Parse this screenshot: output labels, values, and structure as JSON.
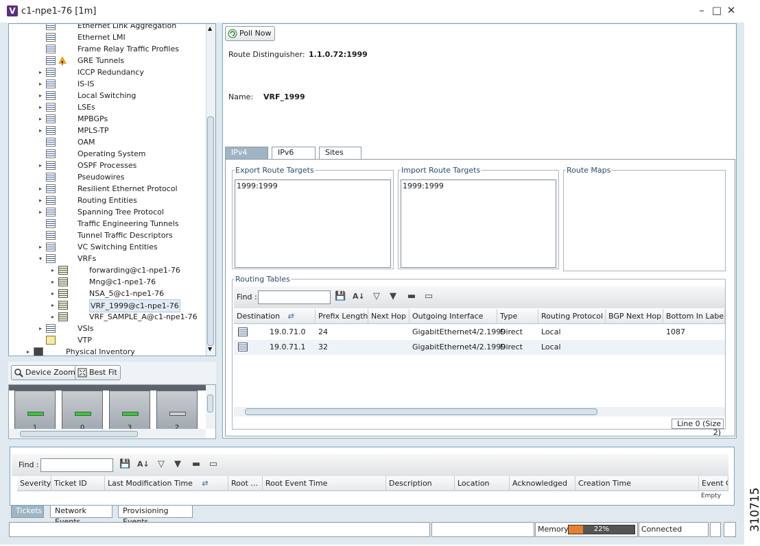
{
  "window": {
    "title": "c1-npe1-76 [1m]",
    "app_letter": "V"
  },
  "tree": {
    "items": [
      {
        "label": "Ethernet Link Aggregation",
        "indent": 1,
        "arrow": "",
        "icon": "gear"
      },
      {
        "label": "Ethernet LMI",
        "indent": 1,
        "arrow": "",
        "icon": "gear"
      },
      {
        "label": "Frame Relay Traffic Profiles",
        "indent": 1,
        "arrow": "",
        "icon": "gear"
      },
      {
        "label": "GRE Tunnels",
        "indent": 1,
        "arrow": "",
        "icon": "gear",
        "warn": true
      },
      {
        "label": "ICCP Redundancy",
        "indent": 1,
        "arrow": "▸",
        "icon": "gear"
      },
      {
        "label": "IS-IS",
        "indent": 1,
        "arrow": "▸",
        "icon": "gear"
      },
      {
        "label": "Local Switching",
        "indent": 1,
        "arrow": "▸",
        "icon": "gear"
      },
      {
        "label": "LSEs",
        "indent": 1,
        "arrow": "▸",
        "icon": "gear"
      },
      {
        "label": "MPBGPs",
        "indent": 1,
        "arrow": "▸",
        "icon": "gear"
      },
      {
        "label": "MPLS-TP",
        "indent": 1,
        "arrow": "▸",
        "icon": "gear"
      },
      {
        "label": "OAM",
        "indent": 1,
        "arrow": "",
        "icon": "gear"
      },
      {
        "label": "Operating System",
        "indent": 1,
        "arrow": "",
        "icon": "gear"
      },
      {
        "label": "OSPF Processes",
        "indent": 1,
        "arrow": "▸",
        "icon": "gear"
      },
      {
        "label": "Pseudowires",
        "indent": 1,
        "arrow": "",
        "icon": "gear"
      },
      {
        "label": "Resilient Ethernet Protocol",
        "indent": 1,
        "arrow": "▸",
        "icon": "gear"
      },
      {
        "label": "Routing Entities",
        "indent": 1,
        "arrow": "▸",
        "icon": "gear"
      },
      {
        "label": "Spanning Tree Protocol",
        "indent": 1,
        "arrow": "▸",
        "icon": "gear"
      },
      {
        "label": "Traffic Engineering Tunnels",
        "indent": 1,
        "arrow": "",
        "icon": "gear"
      },
      {
        "label": "Tunnel Traffic Descriptors",
        "indent": 1,
        "arrow": "",
        "icon": "gear"
      },
      {
        "label": "VC Switching Entities",
        "indent": 1,
        "arrow": "▸",
        "icon": "gear"
      },
      {
        "label": "VRFs",
        "indent": 1,
        "arrow": "▾",
        "icon": "gear"
      },
      {
        "label": "forwarding@c1-npe1-76",
        "indent": 2,
        "arrow": "▸",
        "icon": "vrf"
      },
      {
        "label": "Mng@c1-npe1-76",
        "indent": 2,
        "arrow": "▸",
        "icon": "vrf"
      },
      {
        "label": "NSA_5@c1-npe1-76",
        "indent": 2,
        "arrow": "▸",
        "icon": "vrf"
      },
      {
        "label": "VRF_1999@c1-npe1-76",
        "indent": 2,
        "arrow": "▸",
        "icon": "vrf",
        "selected": true
      },
      {
        "label": "VRF_SAMPLE_A@c1-npe1-76",
        "indent": 2,
        "arrow": "▸",
        "icon": "vrf"
      },
      {
        "label": "VSIs",
        "indent": 1,
        "arrow": "▸",
        "icon": "gear"
      },
      {
        "label": "VTP",
        "indent": 1,
        "arrow": "",
        "icon": "mail"
      },
      {
        "label": "Physical Inventory",
        "indent": 0,
        "arrow": "▸",
        "icon": "chassis"
      }
    ]
  },
  "device_view": {
    "zoom_button": "Device Zoom",
    "fit_button": "Best Fit",
    "slots": [
      {
        "num": "1",
        "led": "#33cc33"
      },
      {
        "num": "0",
        "led": "#33cc33"
      },
      {
        "num": "3",
        "led": "#33cc33"
      },
      {
        "num": "2",
        "led": "#d0d0d0"
      }
    ]
  },
  "main": {
    "poll_button": "Poll Now",
    "rd_label": "Route Distinguisher:",
    "rd_value": "1.1.0.72:1999",
    "name_label": "Name:",
    "name_value": "VRF_1999",
    "tabs": [
      "IPv4",
      "IPv6",
      "Sites"
    ],
    "export_title": "Export Route Targets",
    "export_values": [
      "1999:1999"
    ],
    "import_title": "Import Route Targets",
    "import_values": [
      "1999:1999"
    ],
    "route_maps_title": "Route Maps",
    "routing_tables_title": "Routing Tables",
    "find_label": "Find :",
    "columns": [
      "Destination",
      "Prefix Length",
      "Next Hop",
      "Outgoing Interface",
      "Type",
      "Routing Protocol",
      "BGP Next Hop",
      "Bottom In Label"
    ],
    "rows": [
      {
        "destination": "19.0.71.0",
        "prefix": "24",
        "next_hop": "",
        "interface": "GigabitEthernet4/2.1999",
        "type": "Direct",
        "protocol": "Local",
        "bgp": "",
        "label": "1087"
      },
      {
        "destination": "19.0.71.1",
        "prefix": "32",
        "next_hop": "",
        "interface": "GigabitEthernet4/2.1999",
        "type": "Direct",
        "protocol": "Local",
        "bgp": "",
        "label": ""
      }
    ],
    "table_status": "Line 0 (Size 2)"
  },
  "bottom": {
    "find_label": "Find :",
    "columns": [
      "Severity",
      "Ticket ID",
      "Last Modification Time",
      "Root ...",
      "Root Event Time",
      "Description",
      "Location",
      "Acknowledged",
      "Creation Time",
      "Event C"
    ],
    "empty_text": "Empty",
    "tabs": [
      "Tickets",
      "Network Events",
      "Provisioning Events"
    ]
  },
  "status": {
    "memory_label": "Memory:",
    "memory_percent": 22,
    "memory_text": "22%",
    "connection": "Connected"
  },
  "figure_number": "310715"
}
